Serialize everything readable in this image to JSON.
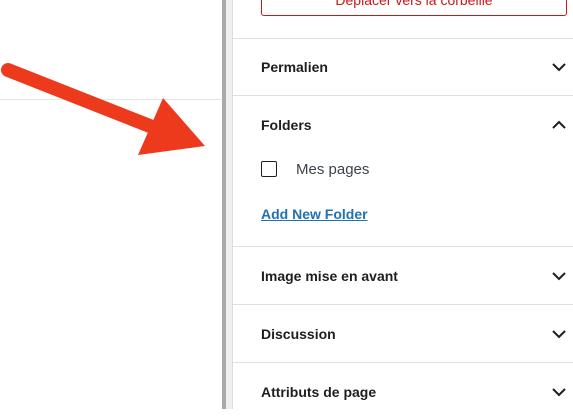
{
  "trash_button_label": "Déplacer vers la corbeille",
  "panels": {
    "permalink": "Permalien",
    "folders": "Folders",
    "featured_image": "Image mise en avant",
    "discussion": "Discussion",
    "page_attributes": "Attributs de page"
  },
  "folders": {
    "items": [
      "Mes pages"
    ],
    "add_new_label": "Add New Folder"
  },
  "colors": {
    "arrow": "#ee3a1c",
    "danger": "#cc1818",
    "link": "#2271b1"
  },
  "icons": {
    "collapsed": "chevron-down-icon",
    "expanded": "chevron-up-icon"
  }
}
